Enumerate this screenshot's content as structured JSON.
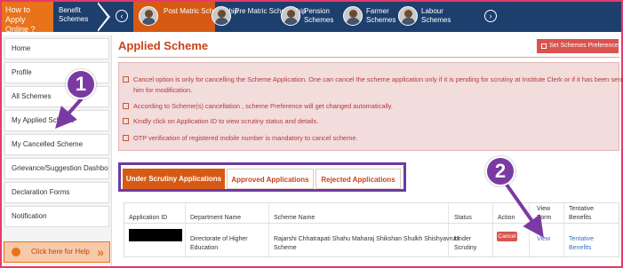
{
  "topnav": {
    "howto": "How to Apply Online ?",
    "benefit": "Benefit Schemes",
    "prev": "‹",
    "next": "›",
    "items": [
      {
        "label": "Post Matric Scholarship"
      },
      {
        "label": "Pre Matric Scholarship"
      },
      {
        "label": "Pension Schemes"
      },
      {
        "label": "Farmer Schemes"
      },
      {
        "label": "Labour Schemes"
      }
    ]
  },
  "sidebar": {
    "items": [
      {
        "label": "Home"
      },
      {
        "label": "Profile"
      },
      {
        "label": "All Schemes"
      },
      {
        "label": "My Applied Scheme"
      },
      {
        "label": "My Cancelled Scheme"
      },
      {
        "label": "Grievance/Suggestion Dashboard"
      },
      {
        "label": "Declaration Forms"
      },
      {
        "label": "Notification"
      }
    ],
    "help": "Click here for Help",
    "help_arrows": "»"
  },
  "main": {
    "title": "Applied Scheme",
    "pref_button": "Set Schemes Preferences",
    "notes": [
      "Cancel option is only for cancelling the Scheme Application. One can cancel the scheme application only if it is pending for scrutiny at Institute Clerk or if it has been sent back to",
      "him for modification.",
      "According to Scheme(s) cancellation , scheme Preference will get changed automatically.",
      "Kindly click on Application ID to view scrutiny status and details.",
      "OTP verification of registered mobile number is mandatory to cancel scheme."
    ],
    "tabs": [
      {
        "label": "Under Scrutiny Applications"
      },
      {
        "label": "Approved Applications"
      },
      {
        "label": "Rejected Applications"
      }
    ],
    "table": {
      "headers": {
        "app_id": "Application ID",
        "dept": "Department Name",
        "scheme": "Scheme Name",
        "status": "Status",
        "action": "Action",
        "view_1": "View",
        "view_2": "Form",
        "tentative_1": "Tentative",
        "tentative_2": "Benefits"
      },
      "row": {
        "dept_1": "Directorate of Higher",
        "dept_2": "Education",
        "scheme_1": "Rajarshi Chhatrapati Shahu Maharaj Shikshan Shulkh Shishyavrutti",
        "scheme_2": "Scheme",
        "status_1": "Under",
        "status_2": "Scrutiny",
        "action": "Cancel",
        "view": "View",
        "tentative_1": "Tentative",
        "tentative_2": "Benefits"
      }
    }
  },
  "callouts": {
    "one": "1",
    "two": "2"
  },
  "colors": {
    "accent": "#d65a14",
    "nav": "#1d3f6e",
    "callout": "#7b3aa3",
    "link": "#3a6fc2"
  }
}
